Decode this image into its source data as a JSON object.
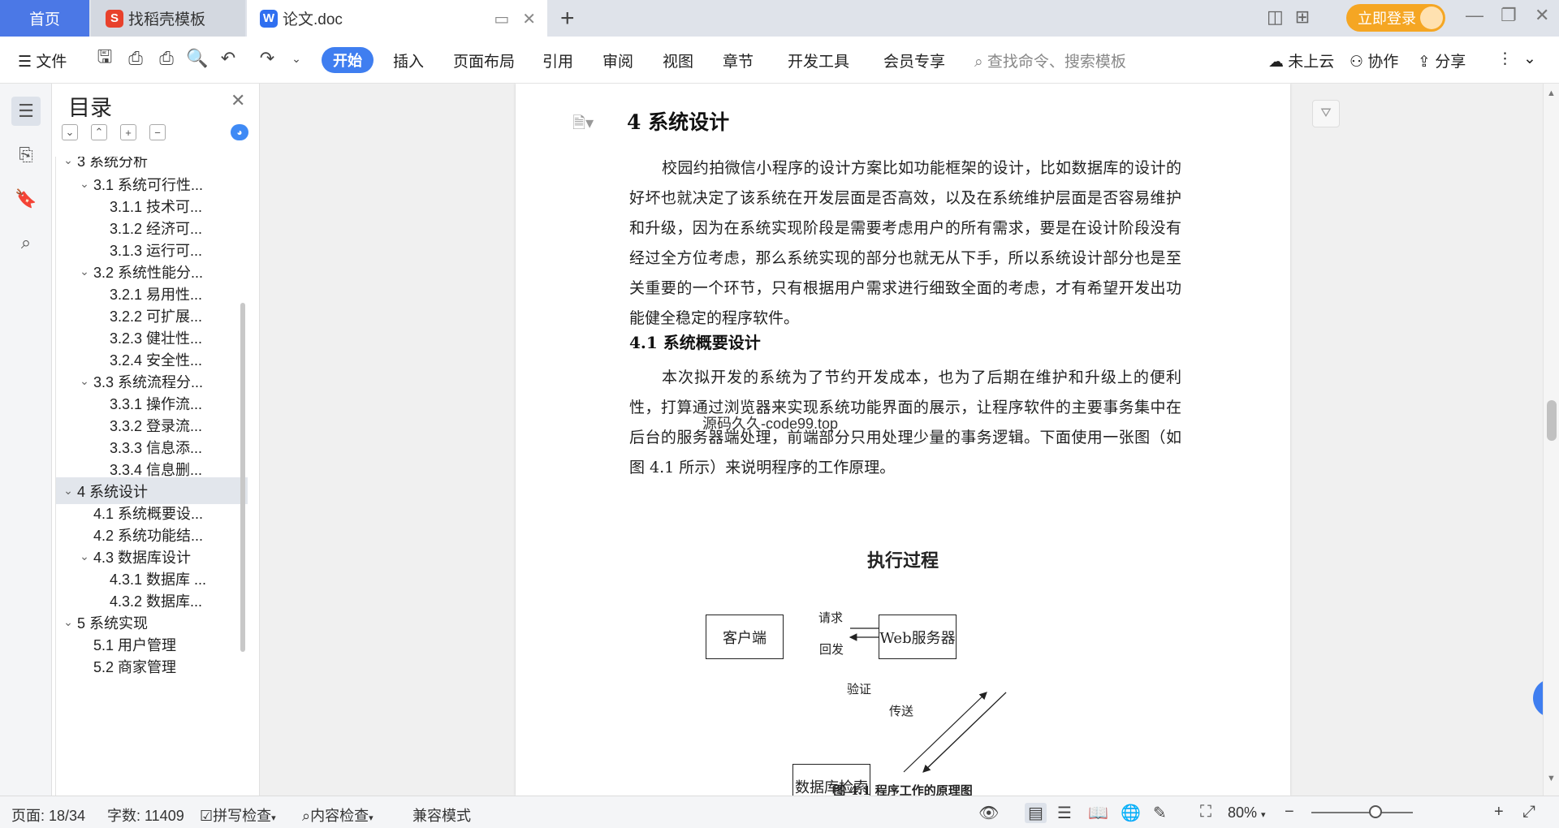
{
  "tabs": {
    "home": "首页",
    "template_tab": "找稻壳模板",
    "doc_tab": "论文.doc",
    "login": "立即登录"
  },
  "toolbar": {
    "file": "文件",
    "menu": [
      "开始",
      "插入",
      "页面布局",
      "引用",
      "审阅",
      "视图",
      "章节",
      "开发工具",
      "会员专享"
    ],
    "search_placeholder": "查找命令、搜索模板",
    "cloud": "未上云",
    "collab": "协作",
    "share": "分享"
  },
  "toc": {
    "title": "目录",
    "items": [
      {
        "label": "3  系统分析"
      },
      {
        "label": "3.1  系统可行性..."
      },
      {
        "label": "3.1.1  技术可..."
      },
      {
        "label": "3.1.2  经济可..."
      },
      {
        "label": "3.1.3  运行可..."
      },
      {
        "label": "3.2  系统性能分..."
      },
      {
        "label": "3.2.1  易用性..."
      },
      {
        "label": "3.2.2  可扩展..."
      },
      {
        "label": "3.2.3  健壮性..."
      },
      {
        "label": "3.2.4  安全性..."
      },
      {
        "label": "3.3  系统流程分..."
      },
      {
        "label": "3.3.1  操作流..."
      },
      {
        "label": "3.3.2  登录流..."
      },
      {
        "label": "3.3.3  信息添..."
      },
      {
        "label": "3.3.4  信息删..."
      },
      {
        "label": "4  系统设计"
      },
      {
        "label": "4.1  系统概要设..."
      },
      {
        "label": "4.2  系统功能结..."
      },
      {
        "label": "4.3  数据库设计"
      },
      {
        "label": "4.3.1  数据库 ..."
      },
      {
        "label": "4.3.2  数据库..."
      },
      {
        "label": "5  系统实现"
      },
      {
        "label": "5.1  用户管理"
      },
      {
        "label": "5.2  商家管理"
      }
    ]
  },
  "document": {
    "heading": "4  系统设计",
    "para1": "校园约拍微信小程序的设计方案比如功能框架的设计，比如数据库的设计的好坏也就决定了该系统在开发层面是否高效，以及在系统维护层面是否容易维护和升级，因为在系统实现阶段是需要考虑用户的所有需求，要是在设计阶段没有经过全方位考虑，那么系统实现的部分也就无从下手，所以系统设计部分也是至关重要的一个环节，只有根据用户需求进行细致全面的考虑，才有希望开发出功能健全稳定的程序软件。",
    "subheading": "4.1  系统概要设计",
    "watermark": "源码久久-code99.top",
    "para2": "本次拟开发的系统为了节约开发成本，也为了后期在维护和升级上的便利性，打算通过浏览器来实现系统功能界面的展示，让程序软件的主要事务集中在后台的服务器端处理，前端部分只用处理少量的事务逻辑。下面使用一张图（如图 4.1 所示）来说明程序的工作原理。",
    "figure": {
      "title": "执行过程",
      "client": "客户端",
      "server": "Web服务器",
      "db": "数据库检索",
      "request": "请求",
      "reply": "回发",
      "verify": "验证",
      "transfer": "传送",
      "caption": "图 4.1  程序工作的原理图"
    }
  },
  "status": {
    "page": "页面: 18/34",
    "words": "字数: 11409",
    "spell": "拼写检查",
    "content": "内容检查",
    "compat": "兼容模式",
    "zoom": "80%"
  }
}
